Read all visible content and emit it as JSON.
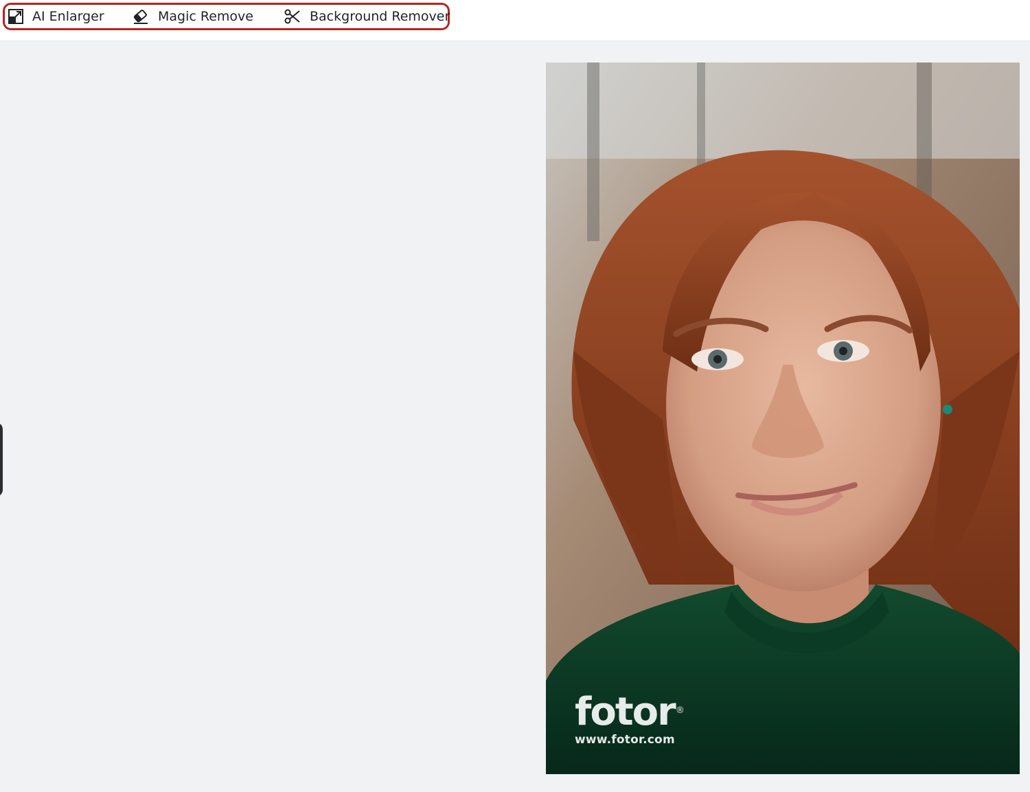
{
  "toolbar": {
    "tools": [
      {
        "label": "AI Enlarger",
        "icon": "enlarge-icon"
      },
      {
        "label": "Magic Remove",
        "icon": "eraser-icon"
      },
      {
        "label": "Background Remover",
        "icon": "scissors-icon"
      }
    ],
    "highlight_color": "#b3261e"
  },
  "canvas": {
    "background": "#f0f2f4",
    "photo": {
      "description_icon": "portrait-photo",
      "watermark": {
        "logo": "fotor",
        "registered": "®",
        "url": "www.fotor.com"
      }
    }
  }
}
